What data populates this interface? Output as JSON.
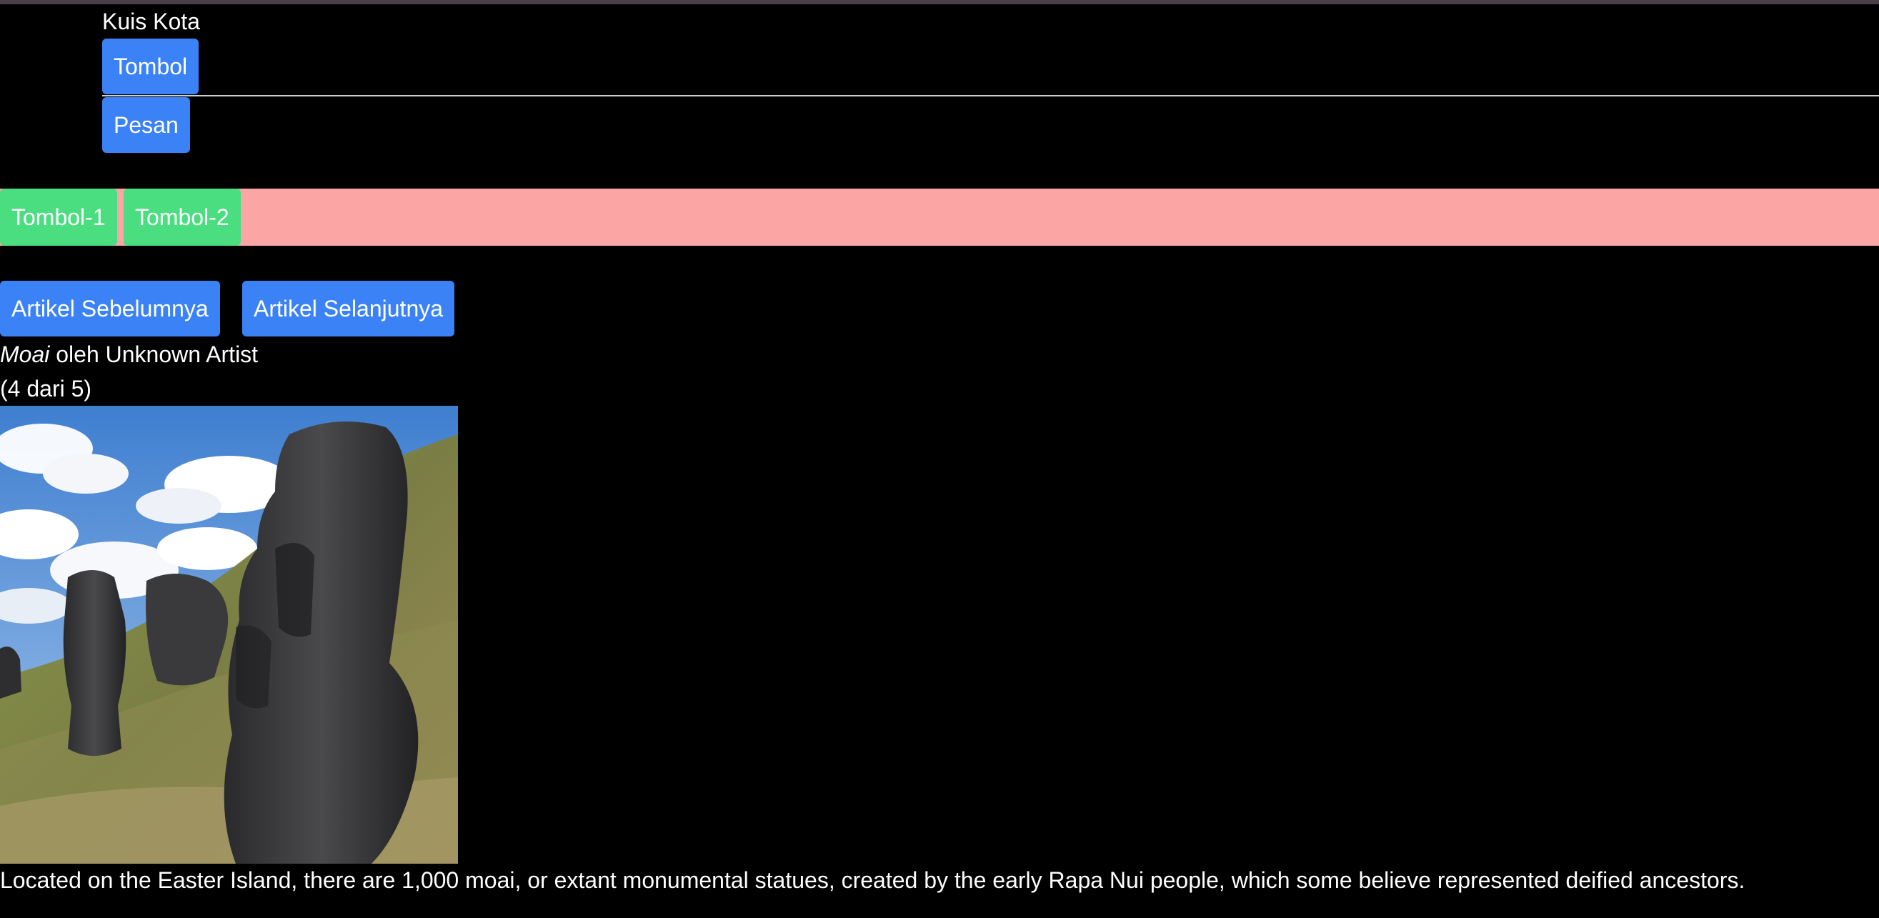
{
  "header": {
    "title": "Kuis Kota",
    "button_label": "Tombol",
    "message_button_label": "Pesan"
  },
  "toolbar": {
    "button1_label": "Tombol-1",
    "button2_label": "Tombol-2"
  },
  "navigation": {
    "prev_label": "Artikel Sebelumnya",
    "next_label": "Artikel Selanjutnya"
  },
  "artwork": {
    "name": "Moai",
    "by_text": " oleh ",
    "artist": "Unknown Artist",
    "counter": "(4 dari 5)",
    "image_icon": "moai-statues-photo",
    "description": "Located on the Easter Island, there are 1,000 moai, or extant monumental statues, created by the early Rapa Nui people, which some believe represented deified ancestors."
  },
  "colors": {
    "background": "#000000",
    "primary_button": "#3b82f6",
    "green_button": "#4ade80",
    "pink_bar": "#fca5a5"
  }
}
